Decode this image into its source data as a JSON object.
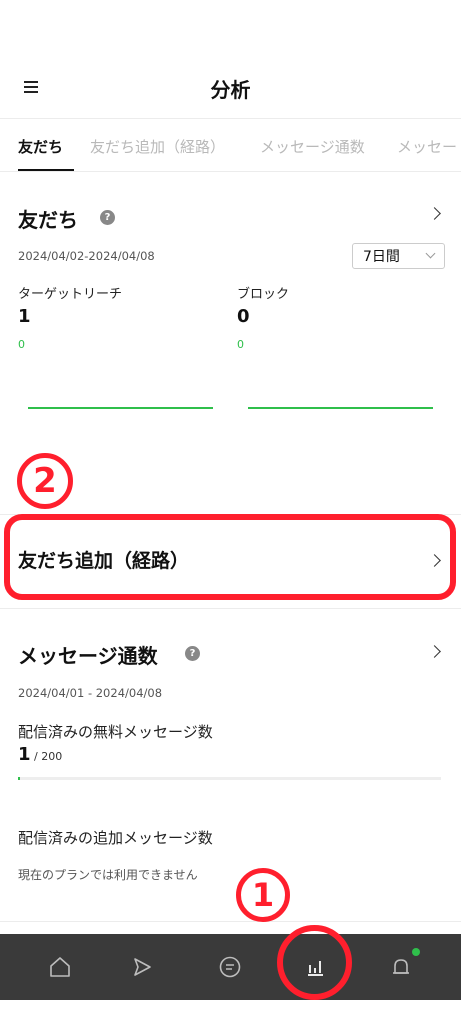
{
  "header": {
    "title": "分析"
  },
  "tabs": [
    {
      "label": "友だち",
      "active": true
    },
    {
      "label": "友だち追加（経路）",
      "active": false
    },
    {
      "label": "メッセージ通数",
      "active": false
    },
    {
      "label": "メッセー",
      "active": false
    }
  ],
  "friends": {
    "title": "友だち",
    "help": "?",
    "date_range": "2024/04/02-2024/04/08",
    "period": "7日間",
    "metrics": [
      {
        "label": "ターゲットリーチ",
        "value": "1",
        "change": "0"
      },
      {
        "label": "ブロック",
        "value": "0",
        "change": "0"
      }
    ]
  },
  "annotations": {
    "step1": "1",
    "step2": "2"
  },
  "add_route": {
    "label": "友だち追加（経路）"
  },
  "messages": {
    "title": "メッセージ通数",
    "help": "?",
    "date_range": "2024/04/01 - 2024/04/08",
    "free_label": "配信済みの無料メッセージ数",
    "free_count": "1",
    "free_limit": " / 200",
    "free_progress": 0.005,
    "extra_label": "配信済みの追加メッセージ数",
    "extra_note": "現在のプランでは利用できません"
  },
  "bottom_nav": {
    "items": [
      "home-icon",
      "voom-icon",
      "chat-icon",
      "analytics-icon",
      "notification-icon"
    ],
    "active": "analytics-icon"
  },
  "colors": {
    "accent_green": "#2fbf4b",
    "annotation_red": "#ff1f2d",
    "nav_bg": "#3a3a3a"
  }
}
